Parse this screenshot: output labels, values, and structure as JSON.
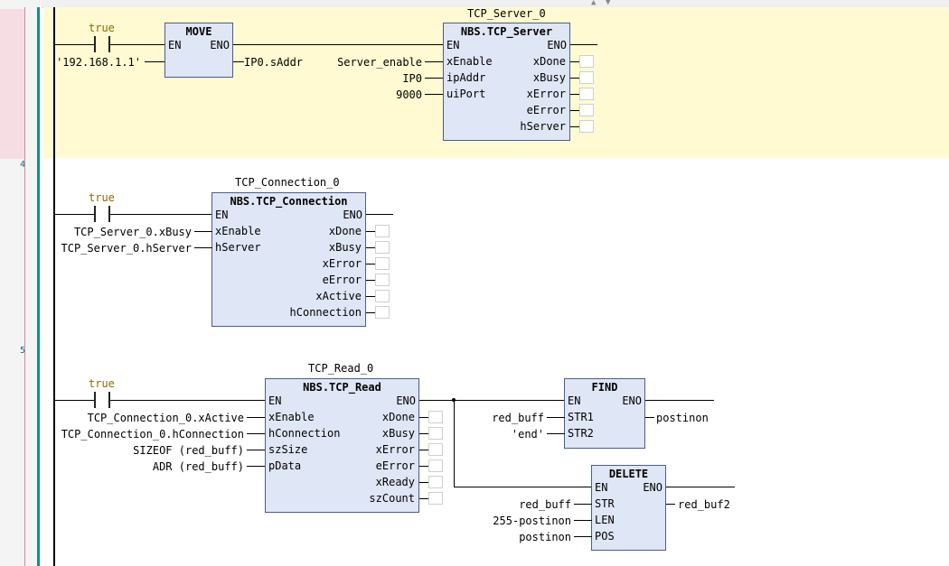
{
  "network_numbers": [
    "4",
    "5"
  ],
  "net3": {
    "contact_value": "true",
    "move": {
      "type": "MOVE",
      "en": "EN",
      "eno": "ENO",
      "input": "'192.168.1.1'",
      "output": "IP0.sAddr"
    },
    "server": {
      "instance": "TCP_Server_0",
      "type": "NBS.TCP_Server",
      "en": "EN",
      "eno": "ENO",
      "inputs": [
        {
          "pin": "xEnable",
          "var": "Server_enable"
        },
        {
          "pin": "ipAddr",
          "var": "IP0"
        },
        {
          "pin": "uiPort",
          "var": "9000"
        }
      ],
      "outputs": [
        "xDone",
        "xBusy",
        "xError",
        "eError",
        "hServer"
      ]
    }
  },
  "net4": {
    "contact_value": "true",
    "conn": {
      "instance": "TCP_Connection_0",
      "type": "NBS.TCP_Connection",
      "en": "EN",
      "eno": "ENO",
      "inputs": [
        {
          "pin": "xEnable",
          "var": "TCP_Server_0.xBusy"
        },
        {
          "pin": "hServer",
          "var": "TCP_Server_0.hServer"
        }
      ],
      "outputs": [
        "xDone",
        "xBusy",
        "xError",
        "eError",
        "xActive",
        "hConnection"
      ]
    }
  },
  "net5": {
    "contact_value": "true",
    "read": {
      "instance": "TCP_Read_0",
      "type": "NBS.TCP_Read",
      "en": "EN",
      "eno": "ENO",
      "inputs": [
        {
          "pin": "xEnable",
          "var": "TCP_Connection_0.xActive"
        },
        {
          "pin": "hConnection",
          "var": "TCP_Connection_0.hConnection"
        },
        {
          "pin": "szSize",
          "var": "SIZEOF (red_buff)"
        },
        {
          "pin": "pData",
          "var": "ADR (red_buff)"
        }
      ],
      "outputs": [
        "xDone",
        "xBusy",
        "xError",
        "eError",
        "xReady",
        "szCount"
      ]
    },
    "find": {
      "type": "FIND",
      "en": "EN",
      "eno": "ENO",
      "inputs": [
        {
          "pin": "STR1",
          "var": "red_buff"
        },
        {
          "pin": "STR2",
          "var": "'end'"
        }
      ],
      "output": "postinon"
    },
    "delete": {
      "type": "DELETE",
      "en": "EN",
      "eno": "ENO",
      "inputs": [
        {
          "pin": "STR",
          "var": "red_buff"
        },
        {
          "pin": "LEN",
          "var": "255-postinon"
        },
        {
          "pin": "POS",
          "var": "postinon"
        }
      ],
      "output": "red_buf2"
    }
  }
}
